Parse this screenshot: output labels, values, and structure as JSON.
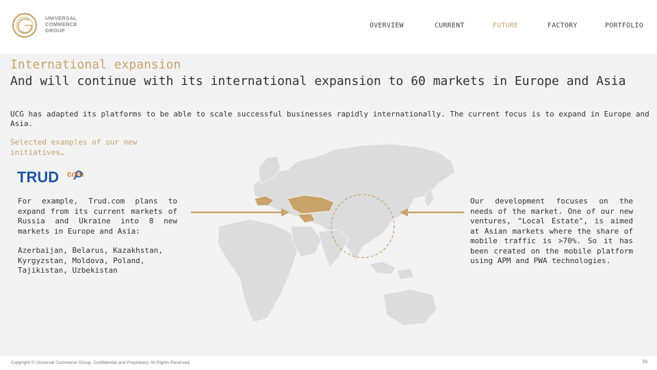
{
  "logo": {
    "line1": "UNIVERSAL",
    "line2": "COMMERCE",
    "line3": "GROUP"
  },
  "nav": {
    "items": [
      {
        "label": "OVERVIEW"
      },
      {
        "label": "CURRENT"
      },
      {
        "label": "FUTURE"
      },
      {
        "label": "FACTORY"
      },
      {
        "label": "PORTFOLIO"
      }
    ],
    "active": "FUTURE"
  },
  "main": {
    "kicker": "International expansion",
    "headline": "And will continue with its international expansion to 60 markets in Europe and Asia",
    "lead": "UCG has adapted its platforms to be able to scale successful businesses rapidly internationally.  The current focus is to expand in Europe and Asia.",
    "examples_label": "Selected examples of our new initiatives…",
    "trud_logo": {
      "word": "TRUD",
      "suffix": "com"
    },
    "left_paragraph": "For example, Trud.com plans to expand from its current markets of Russia and Ukraine into 8 new markets in Europe and Asia:",
    "left_countries": "Azerbaijan, Belarus, Kazakhstan, Kyrgyzstan, Moldova, Poland, Tajikistan, Uzbekistan",
    "right_paragraph": "Our development focuses on the needs of the market.  One of our new ventures, \"Local Estate\", is aimed at Asian markets where the share of mobile traffic is >70%. So it has been created on the mobile platform using APM and PWA technologies."
  },
  "colors": {
    "accent": "#c9a36a",
    "map_land": "#dcdcdc",
    "highlight": "#c9a36a",
    "background": "#f3f3f3"
  },
  "footer": {
    "copyright": "Copyright © Universal Commerce Group. Confidential and Proprietary. All Rights Reserved.",
    "page": "33"
  }
}
